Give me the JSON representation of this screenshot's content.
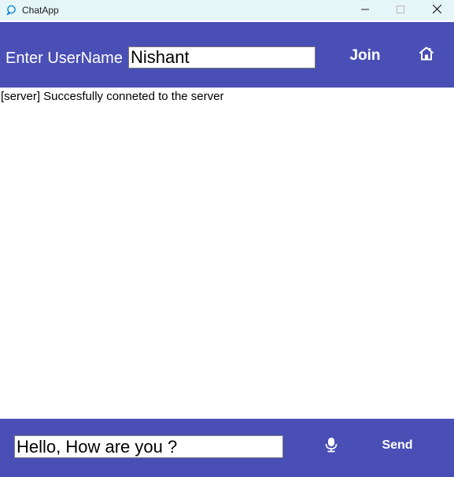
{
  "window": {
    "title": "ChatApp",
    "app_icon": "chat-bubble-icon",
    "controls": [
      "minimize-icon",
      "maximize-icon",
      "close-icon"
    ]
  },
  "header": {
    "username_label": "Enter UserName",
    "username_value": "Nishant",
    "join_label": "Join",
    "home_icon": "home-icon"
  },
  "messages": [
    "[server] Succesfully conneted to the server"
  ],
  "footer": {
    "message_value": "Hello, How are you ?",
    "mic_icon": "microphone-icon",
    "send_label": "Send"
  },
  "colors": {
    "titlebar": "#e6f5f8",
    "bar": "#4a4fb5",
    "bar_text": "#ffffff"
  }
}
